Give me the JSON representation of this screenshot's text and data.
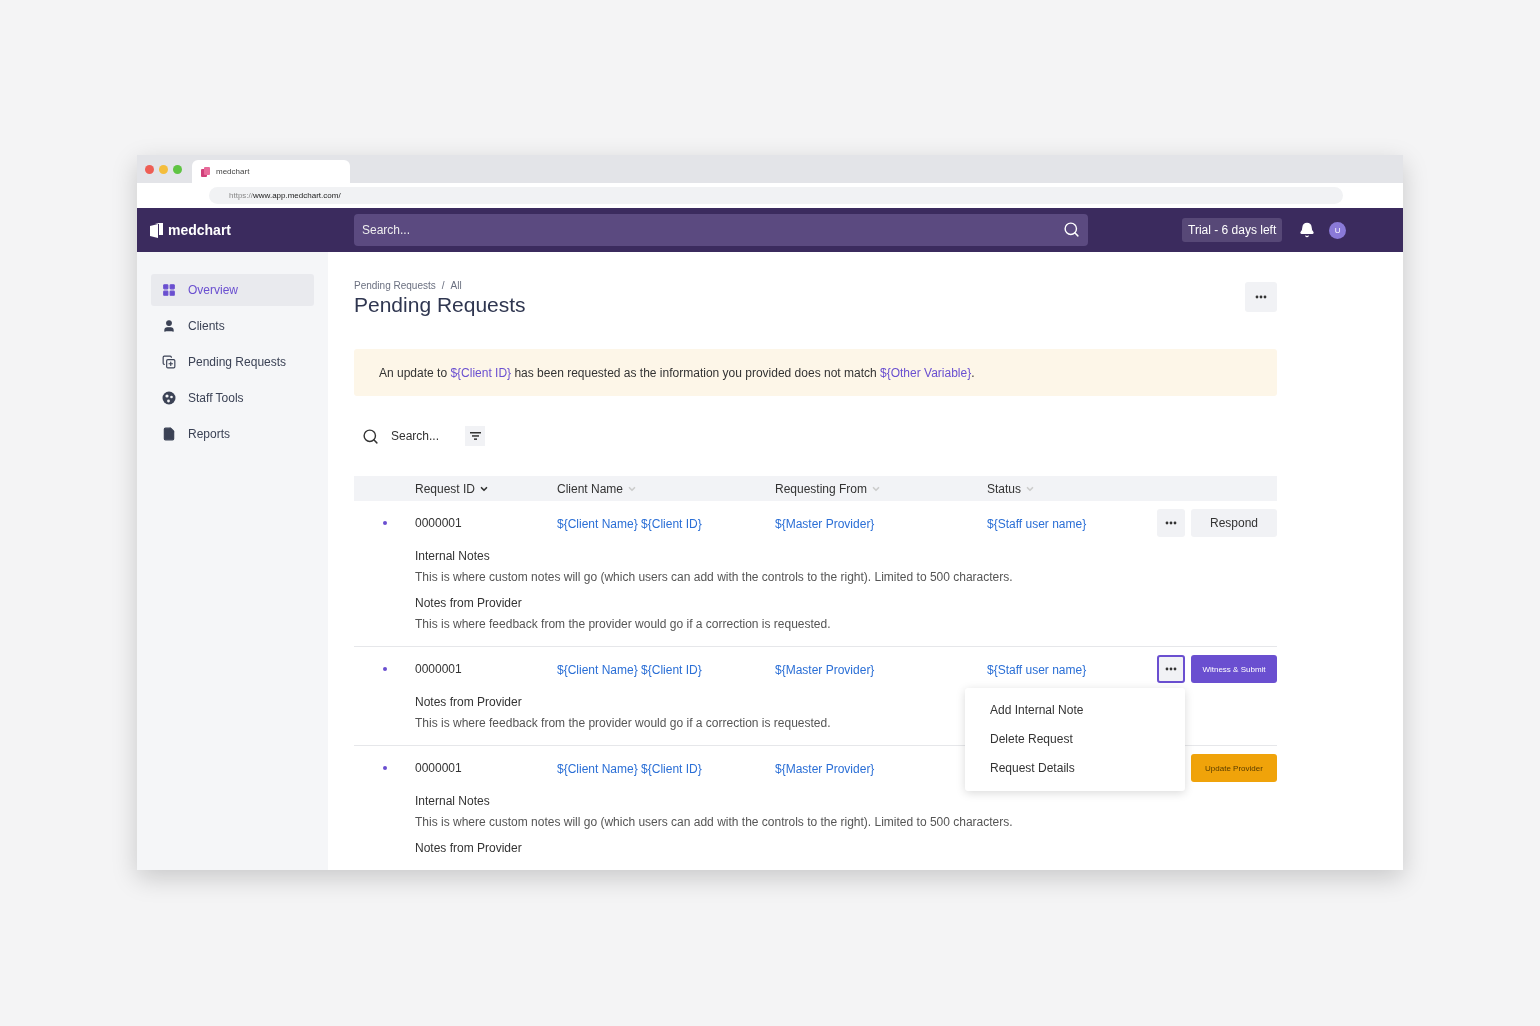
{
  "browser": {
    "tab_title": "medchart",
    "url_prefix": "https://",
    "url": "www.app.medchart.com/"
  },
  "header": {
    "logo": "medchart",
    "search": {
      "placeholder": "Search..."
    },
    "trial_badge": "Trial - 6 days left",
    "avatar": "U"
  },
  "sidebar": {
    "items": [
      {
        "label": "Overview",
        "selected": true
      },
      {
        "label": "Clients",
        "selected": false
      },
      {
        "label": "Pending Requests",
        "selected": false
      },
      {
        "label": "Staff Tools",
        "selected": false
      },
      {
        "label": "Reports",
        "selected": false
      }
    ]
  },
  "breadcrumb": {
    "items": [
      "Pending Requests",
      "All"
    ],
    "separator": "/"
  },
  "page_title": "Pending Requests",
  "alert": [
    {
      "kind": "text",
      "text": "An update to "
    },
    {
      "kind": "variable",
      "text": "${Client ID}"
    },
    {
      "kind": "text",
      "text": " has been requested as the information you provided does not match "
    },
    {
      "kind": "variable",
      "text": "${Other Variable}"
    },
    {
      "kind": "text",
      "text": "."
    }
  ],
  "table_search": {
    "placeholder": "Search..."
  },
  "table": {
    "columns": [
      {
        "label": "Request ID",
        "sorted": true
      },
      {
        "label": "Client Name",
        "sorted": false
      },
      {
        "label": "Requesting From",
        "sorted": false
      },
      {
        "label": "Status",
        "sorted": false
      }
    ],
    "rows": [
      {
        "id": "0000001",
        "client": "${Client Name} ${Client ID}",
        "from": "${Master Provider}",
        "status": "${Staff user name}",
        "menu_button": {
          "focused": false
        },
        "action": {
          "label": "Respond",
          "kind": "secondary"
        },
        "notes": [
          {
            "label": "Internal Notes",
            "text": "This is where custom notes will go (which users can add with the controls to the right). Limited to 500 characters."
          },
          {
            "label": "Notes from Provider",
            "text": "This is where feedback from the provider would go if a correction is requested."
          }
        ]
      },
      {
        "id": "0000001",
        "client": "${Client Name} ${Client ID}",
        "from": "${Master Provider}",
        "status": "${Staff user name}",
        "menu_button": {
          "focused": true,
          "menu": [
            "Add Internal Note",
            "Delete Request",
            "Request Details"
          ]
        },
        "action": {
          "label": "Witness & Submit",
          "kind": "primary"
        },
        "notes": [
          {
            "label": "Notes from Provider",
            "text": "This is where feedback from the provider would go if a correction is requested."
          }
        ]
      },
      {
        "id": "0000001",
        "client": "${Client Name} ${Client ID}",
        "from": "${Master Provider}",
        "action": {
          "label": "Update Provider",
          "kind": "warning"
        },
        "notes": [
          {
            "label": "Internal Notes",
            "text": "This is where custom notes will go (which users can add with the controls to the right). Limited to 500 characters."
          },
          {
            "label": "Notes from Provider"
          }
        ]
      }
    ]
  }
}
